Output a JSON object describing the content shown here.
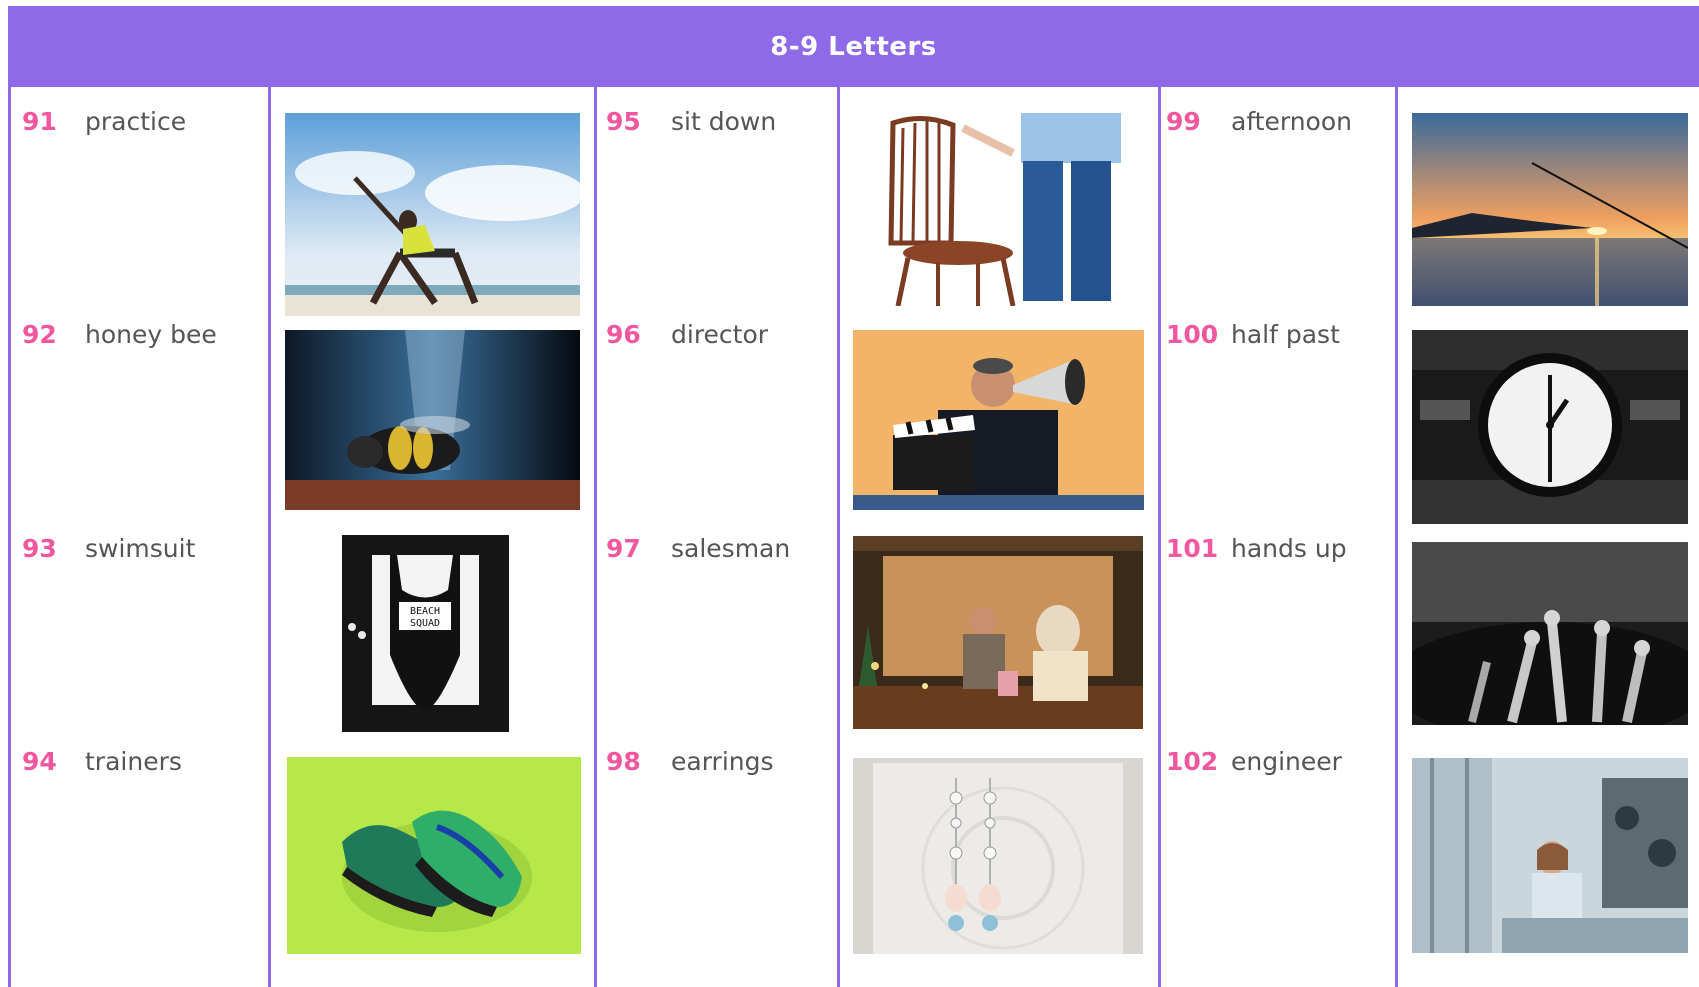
{
  "header": {
    "title": "8-9 Letters"
  },
  "columns": [
    {
      "items": [
        {
          "number": "91",
          "word": "practice",
          "image": "yoga-on-beach"
        },
        {
          "number": "92",
          "word": "honey bee",
          "image": "honey-bee"
        },
        {
          "number": "93",
          "word": "swimsuit",
          "image": "beach-squad-swimsuit"
        },
        {
          "number": "94",
          "word": "trainers",
          "image": "green-sneakers"
        }
      ]
    },
    {
      "items": [
        {
          "number": "95",
          "word": "sit down",
          "image": "chair-and-person"
        },
        {
          "number": "96",
          "word": "director",
          "image": "director-with-megaphone"
        },
        {
          "number": "97",
          "word": "salesman",
          "image": "shop-salesman"
        },
        {
          "number": "98",
          "word": "earrings",
          "image": "drop-earrings"
        }
      ]
    },
    {
      "items": [
        {
          "number": "99",
          "word": "afternoon",
          "image": "sunset-over-sea"
        },
        {
          "number": "100",
          "word": "half past",
          "image": "station-clock"
        },
        {
          "number": "101",
          "word": "hands up",
          "image": "crowd-hands-up"
        },
        {
          "number": "102",
          "word": "engineer",
          "image": "factory-engineer"
        }
      ]
    }
  ],
  "photo_text": {
    "swimsuit_print": "BEACH SQUAD"
  },
  "colors": {
    "accent": "#8f6ae8",
    "number": "#f0579e",
    "text": "#555555"
  }
}
